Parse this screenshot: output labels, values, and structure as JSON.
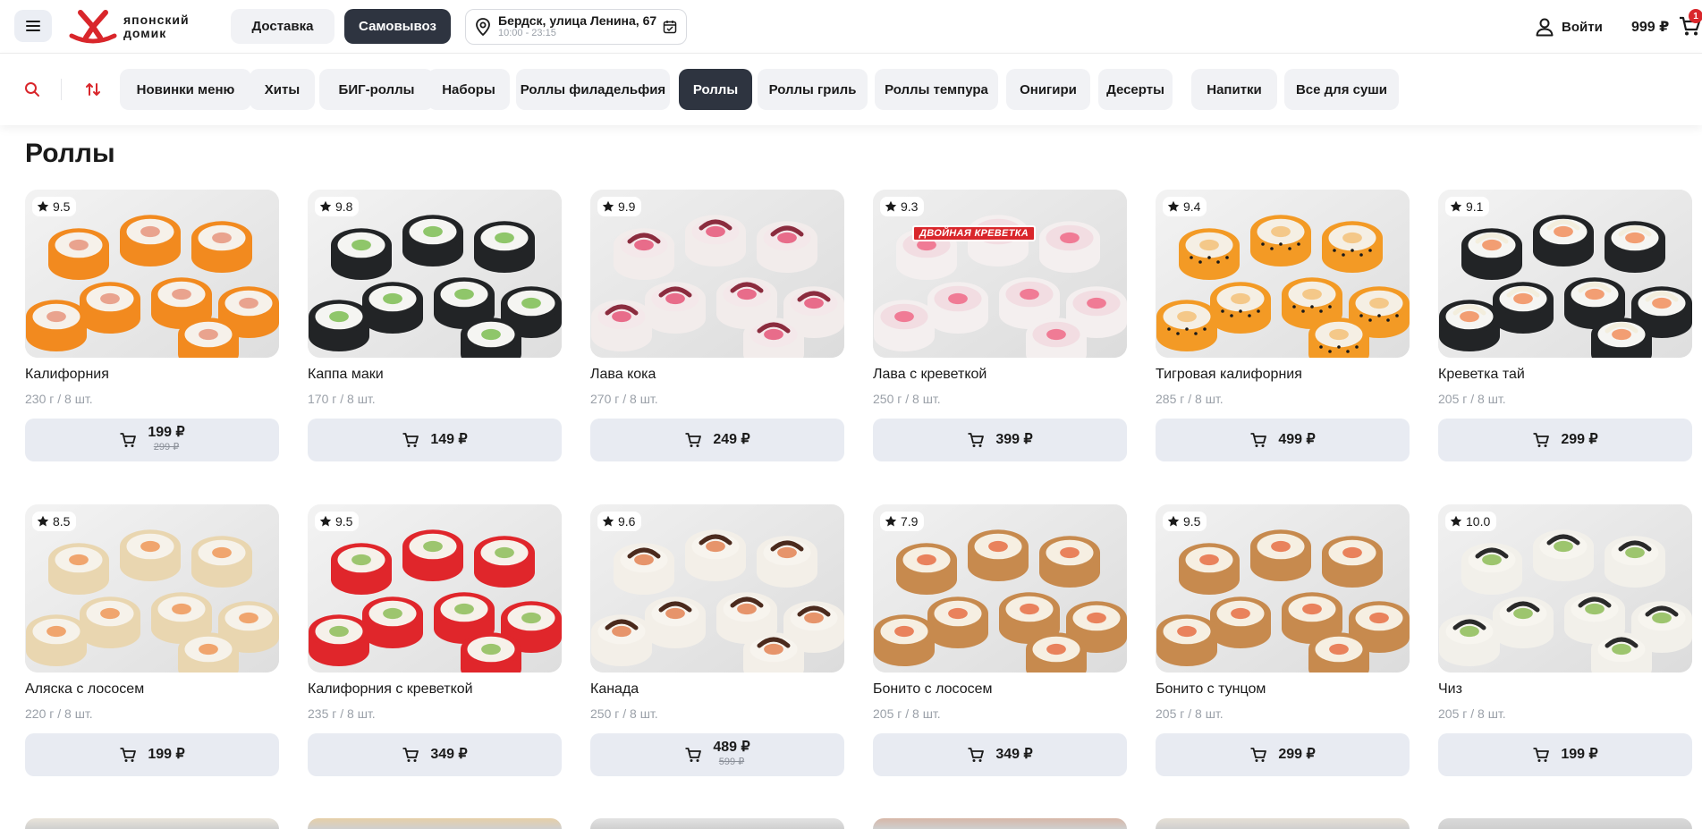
{
  "header": {
    "logo_text_line1": "японский",
    "logo_text_line2": "домик",
    "delivery_label": "Доставка",
    "pickup_label": "Самовывоз",
    "address": "Бердск, улица Ленина, 67",
    "hours": "10:00 - 23:15",
    "login_label": "Войти",
    "cart_total": "999 ₽",
    "cart_count": "1"
  },
  "categories": [
    {
      "label": "Новинки меню",
      "active": false
    },
    {
      "label": "Хиты",
      "active": false
    },
    {
      "label": "БИГ-роллы",
      "active": false
    },
    {
      "label": "Наборы",
      "active": false
    },
    {
      "label": "Роллы филадельфия",
      "active": false
    },
    {
      "label": "Роллы",
      "active": true
    },
    {
      "label": "Роллы гриль",
      "active": false
    },
    {
      "label": "Роллы темпура",
      "active": false
    },
    {
      "label": "Онигири",
      "active": false
    },
    {
      "label": "Десерты",
      "active": false
    },
    {
      "label": "Напитки",
      "active": false
    },
    {
      "label": "Все для суши",
      "active": false
    }
  ],
  "section_title": "Роллы",
  "products": [
    {
      "name": "Калифорния",
      "weight": "230 г / 8 шт.",
      "rating": "9.5",
      "price": "199 ₽",
      "old_price": "299 ₽",
      "badge": "",
      "style": "orange"
    },
    {
      "name": "Каппа маки",
      "weight": "170 г / 8 шт.",
      "rating": "9.8",
      "price": "149 ₽",
      "old_price": "",
      "badge": "",
      "style": "nori"
    },
    {
      "name": "Лава кока",
      "weight": "270 г / 8 шт.",
      "rating": "9.9",
      "price": "249 ₽",
      "old_price": "",
      "badge": "",
      "style": "pinkdrizzle"
    },
    {
      "name": "Лава с креветкой",
      "weight": "250 г / 8 шт.",
      "rating": "9.3",
      "price": "399 ₽",
      "old_price": "",
      "badge": "ДВОЙНАЯ КРЕВЕТКА",
      "style": "pink"
    },
    {
      "name": "Тигровая калифорния",
      "weight": "285 г / 8 шт.",
      "rating": "9.4",
      "price": "499 ₽",
      "old_price": "",
      "badge": "",
      "style": "tiger"
    },
    {
      "name": "Креветка тай",
      "weight": "205 г / 8 шт.",
      "rating": "9.1",
      "price": "299 ₽",
      "old_price": "",
      "badge": "",
      "style": "norishrimp"
    },
    {
      "name": "Аляска с лососем",
      "weight": "220 г / 8 шт.",
      "rating": "8.5",
      "price": "199 ₽",
      "old_price": "",
      "badge": "",
      "style": "sesame"
    },
    {
      "name": "Калифорния с креветкой",
      "weight": "235 г / 8 шт.",
      "rating": "9.5",
      "price": "349 ₽",
      "old_price": "",
      "badge": "",
      "style": "red"
    },
    {
      "name": "Канада",
      "weight": "250 г / 8 шт.",
      "rating": "9.6",
      "price": "489 ₽",
      "old_price": "599 ₽",
      "badge": "",
      "style": "eel"
    },
    {
      "name": "Бонито с лососем",
      "weight": "205 г / 8 шт.",
      "rating": "7.9",
      "price": "349 ₽",
      "old_price": "",
      "badge": "",
      "style": "bonito"
    },
    {
      "name": "Бонито с тунцом",
      "weight": "205 г / 8 шт.",
      "rating": "9.5",
      "price": "299 ₽",
      "old_price": "",
      "badge": "",
      "style": "bonito"
    },
    {
      "name": "Чиз",
      "weight": "205 г / 8 шт.",
      "rating": "10.0",
      "price": "199 ₽",
      "old_price": "",
      "badge": "",
      "style": "flakes"
    }
  ],
  "colors": {
    "accent": "#d9262b",
    "dark_chip": "#2e3440",
    "chip": "#f1f2f5",
    "buy_button": "#e8ebf2"
  },
  "icons": {
    "menu": "hamburger-icon",
    "location": "map-pin-icon",
    "calendar": "calendar-icon",
    "user": "user-icon",
    "cart": "cart-icon",
    "search": "search-icon",
    "sort": "sort-icon",
    "star": "star-icon"
  }
}
